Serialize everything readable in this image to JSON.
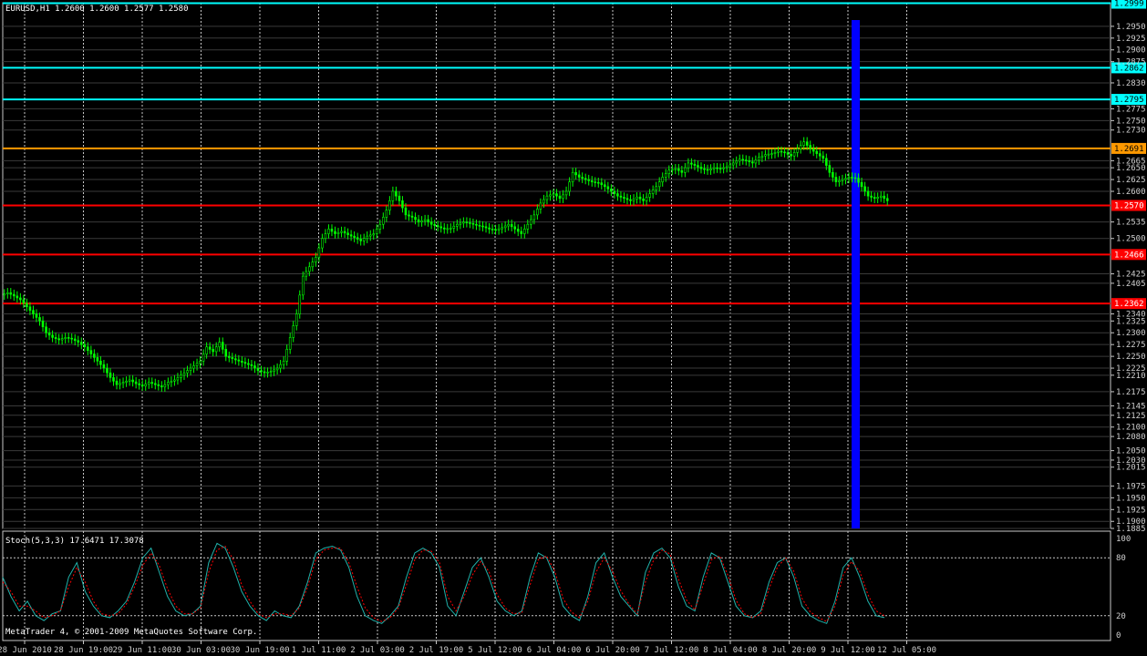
{
  "window": {
    "main_header": "EURUSD,H1  1.2600 1.2600 1.2577 1.2580",
    "indicator_header": "Stoch(5,3,3) 17.6471 17.3078",
    "copyright": "MetaTrader 4, © 2001-2009 MetaQuotes Software Corp."
  },
  "colors": {
    "background": "#000000",
    "grid": "#c8c8c8",
    "bull_candle": "#00ff00",
    "bear_candle": "#00ff00",
    "stoch_main": "#20b2aa",
    "stoch_signal": "#ff0000",
    "resistance_line": "#00ffff",
    "pivot_line": "#ff9900",
    "support_line": "#ff0000",
    "highlight_bar": "#0000ff"
  },
  "chart_data": [
    {
      "type": "candlestick",
      "symbol": "EURUSD",
      "timeframe": "H1",
      "ylim": [
        1.1885,
        1.3
      ],
      "price_labels": [
        "1.2950",
        "1.2925",
        "1.2900",
        "1.2875",
        "1.2830",
        "1.2775",
        "1.2750",
        "1.2730",
        "1.2665",
        "1.2650",
        "1.2625",
        "1.2600",
        "1.2535",
        "1.2500",
        "1.2425",
        "1.2405",
        "1.2340",
        "1.2325",
        "1.2300",
        "1.2275",
        "1.2250",
        "1.2225",
        "1.2210",
        "1.2175",
        "1.2145",
        "1.2125",
        "1.2100",
        "1.2080",
        "1.2050",
        "1.2030",
        "1.2015",
        "1.1975",
        "1.1950",
        "1.1925",
        "1.1900",
        "1.1885"
      ],
      "horizontal_lines": [
        {
          "value": 1.2999,
          "label": "1.2999",
          "kind": "resistance"
        },
        {
          "value": 1.2862,
          "label": "1.2862",
          "kind": "resistance"
        },
        {
          "value": 1.2795,
          "label": "1.2795",
          "kind": "resistance"
        },
        {
          "value": 1.2691,
          "label": "1.2691",
          "kind": "pivot"
        },
        {
          "value": 1.257,
          "label": "1.2570",
          "kind": "support"
        },
        {
          "value": 1.2466,
          "label": "1.2466",
          "kind": "support"
        },
        {
          "value": 1.2362,
          "label": "1.2362",
          "kind": "support"
        }
      ],
      "time_labels": [
        "28 Jun 2010",
        "28 Jun 19:00",
        "29 Jun 11:00",
        "30 Jun 03:00",
        "30 Jun 19:00",
        "1 Jul 11:00",
        "2 Jul 03:00",
        "2 Jul 19:00",
        "5 Jul 12:00",
        "6 Jul 04:00",
        "6 Jul 20:00",
        "7 Jul 12:00",
        "8 Jul 04:00",
        "8 Jul 20:00",
        "9 Jul 12:00",
        "12 Jul 05:00"
      ],
      "close_path": [
        [
          0,
          1.238
        ],
        [
          2,
          1.2385
        ],
        [
          4,
          1.2378
        ],
        [
          6,
          1.237
        ],
        [
          8,
          1.2355
        ],
        [
          10,
          1.234
        ],
        [
          12,
          1.2325
        ],
        [
          14,
          1.23
        ],
        [
          16,
          1.229
        ],
        [
          18,
          1.2285
        ],
        [
          20,
          1.229
        ],
        [
          22,
          1.2287
        ],
        [
          24,
          1.228
        ],
        [
          26,
          1.227
        ],
        [
          28,
          1.2255
        ],
        [
          30,
          1.224
        ],
        [
          32,
          1.2225
        ],
        [
          34,
          1.2205
        ],
        [
          36,
          1.219
        ],
        [
          38,
          1.2195
        ],
        [
          40,
          1.22
        ],
        [
          42,
          1.2192
        ],
        [
          44,
          1.2187
        ],
        [
          46,
          1.2195
        ],
        [
          48,
          1.219
        ],
        [
          50,
          1.2185
        ],
        [
          52,
          1.2195
        ],
        [
          54,
          1.22
        ],
        [
          56,
          1.221
        ],
        [
          58,
          1.222
        ],
        [
          60,
          1.223
        ],
        [
          62,
          1.224
        ],
        [
          64,
          1.227
        ],
        [
          66,
          1.226
        ],
        [
          68,
          1.228
        ],
        [
          70,
          1.225
        ],
        [
          72,
          1.2245
        ],
        [
          74,
          1.224
        ],
        [
          76,
          1.2235
        ],
        [
          78,
          1.223
        ],
        [
          80,
          1.222
        ],
        [
          82,
          1.2215
        ],
        [
          84,
          1.2218
        ],
        [
          86,
          1.2225
        ],
        [
          88,
          1.224
        ],
        [
          90,
          1.229
        ],
        [
          92,
          1.234
        ],
        [
          94,
          1.242
        ],
        [
          96,
          1.244
        ],
        [
          98,
          1.246
        ],
        [
          100,
          1.25
        ],
        [
          102,
          1.252
        ],
        [
          104,
          1.251
        ],
        [
          106,
          1.2515
        ],
        [
          108,
          1.2508
        ],
        [
          110,
          1.2502
        ],
        [
          112,
          1.2495
        ],
        [
          114,
          1.2505
        ],
        [
          116,
          1.251
        ],
        [
          118,
          1.253
        ],
        [
          120,
          1.256
        ],
        [
          122,
          1.26
        ],
        [
          124,
          1.258
        ],
        [
          126,
          1.255
        ],
        [
          128,
          1.2545
        ],
        [
          130,
          1.2535
        ],
        [
          132,
          1.254
        ],
        [
          134,
          1.253
        ],
        [
          136,
          1.2525
        ],
        [
          138,
          1.252
        ],
        [
          140,
          1.2522
        ],
        [
          142,
          1.253
        ],
        [
          144,
          1.2535
        ],
        [
          146,
          1.2532
        ],
        [
          148,
          1.2528
        ],
        [
          150,
          1.2525
        ],
        [
          152,
          1.252
        ],
        [
          154,
          1.2518
        ],
        [
          156,
          1.2523
        ],
        [
          158,
          1.253
        ],
        [
          160,
          1.252
        ],
        [
          162,
          1.251
        ],
        [
          164,
          1.253
        ],
        [
          166,
          1.255
        ],
        [
          168,
          1.2575
        ],
        [
          170,
          1.259
        ],
        [
          172,
          1.2595
        ],
        [
          174,
          1.2585
        ],
        [
          176,
          1.26
        ],
        [
          178,
          1.264
        ],
        [
          180,
          1.263
        ],
        [
          182,
          1.2625
        ],
        [
          184,
          1.262
        ],
        [
          186,
          1.2618
        ],
        [
          188,
          1.261
        ],
        [
          190,
          1.26
        ],
        [
          192,
          1.259
        ],
        [
          194,
          1.2585
        ],
        [
          196,
          1.258
        ],
        [
          198,
          1.2588
        ],
        [
          200,
          1.258
        ],
        [
          202,
          1.2595
        ],
        [
          204,
          1.261
        ],
        [
          206,
          1.263
        ],
        [
          208,
          1.2645
        ],
        [
          210,
          1.2648
        ],
        [
          212,
          1.264
        ],
        [
          214,
          1.266
        ],
        [
          216,
          1.2655
        ],
        [
          218,
          1.2648
        ],
        [
          220,
          1.2645
        ],
        [
          222,
          1.265
        ],
        [
          224,
          1.2648
        ],
        [
          226,
          1.2652
        ],
        [
          228,
          1.266
        ],
        [
          230,
          1.2668
        ],
        [
          232,
          1.2665
        ],
        [
          234,
          1.266
        ],
        [
          236,
          1.2672
        ],
        [
          238,
          1.2678
        ],
        [
          240,
          1.268
        ],
        [
          242,
          1.2685
        ],
        [
          244,
          1.2682
        ],
        [
          246,
          1.2675
        ],
        [
          248,
          1.269
        ],
        [
          250,
          1.2705
        ],
        [
          252,
          1.269
        ],
        [
          254,
          1.268
        ],
        [
          256,
          1.267
        ],
        [
          258,
          1.264
        ],
        [
          260,
          1.262
        ],
        [
          262,
          1.2625
        ],
        [
          264,
          1.263
        ],
        [
          266,
          1.2628
        ],
        [
          268,
          1.261
        ],
        [
          270,
          1.259
        ],
        [
          272,
          1.2585
        ],
        [
          274,
          1.259
        ],
        [
          276,
          1.258
        ]
      ]
    },
    {
      "type": "line",
      "name": "Stoch(5,3,3)",
      "ylim": [
        0,
        100
      ],
      "levels": [
        "100",
        "80",
        "20",
        "0"
      ],
      "series": [
        {
          "name": "main",
          "values": [
            60,
            40,
            25,
            35,
            20,
            15,
            22,
            25,
            60,
            75,
            45,
            30,
            20,
            18,
            25,
            35,
            55,
            80,
            90,
            65,
            40,
            25,
            20,
            22,
            30,
            75,
            95,
            90,
            70,
            45,
            30,
            20,
            15,
            25,
            20,
            18,
            30,
            55,
            85,
            90,
            92,
            88,
            70,
            40,
            20,
            15,
            12,
            20,
            30,
            60,
            85,
            90,
            85,
            70,
            30,
            20,
            45,
            70,
            80,
            60,
            35,
            25,
            20,
            25,
            60,
            85,
            80,
            60,
            30,
            20,
            15,
            40,
            75,
            85,
            60,
            40,
            30,
            20,
            65,
            85,
            90,
            80,
            50,
            30,
            25,
            60,
            85,
            80,
            55,
            30,
            20,
            18,
            25,
            55,
            75,
            80,
            60,
            30,
            20,
            15,
            12,
            35,
            70,
            80,
            60,
            35,
            20,
            18
          ]
        },
        {
          "name": "signal",
          "values": [
            55,
            45,
            30,
            30,
            25,
            18,
            20,
            25,
            50,
            70,
            55,
            35,
            22,
            20,
            22,
            32,
            50,
            72,
            85,
            72,
            48,
            30,
            22,
            22,
            28,
            65,
            88,
            92,
            78,
            52,
            35,
            22,
            18,
            22,
            22,
            20,
            28,
            50,
            78,
            88,
            90,
            90,
            75,
            50,
            28,
            18,
            14,
            18,
            28,
            52,
            78,
            88,
            87,
            75,
            40,
            25,
            40,
            62,
            76,
            66,
            42,
            28,
            22,
            23,
            52,
            78,
            82,
            66,
            38,
            24,
            18,
            35,
            65,
            80,
            66,
            46,
            32,
            22,
            55,
            78,
            88,
            84,
            58,
            36,
            26,
            52,
            78,
            82,
            62,
            36,
            22,
            18,
            22,
            48,
            70,
            80,
            66,
            38,
            24,
            18,
            14,
            30,
            62,
            76,
            66,
            42,
            25,
            20
          ]
        }
      ]
    }
  ]
}
